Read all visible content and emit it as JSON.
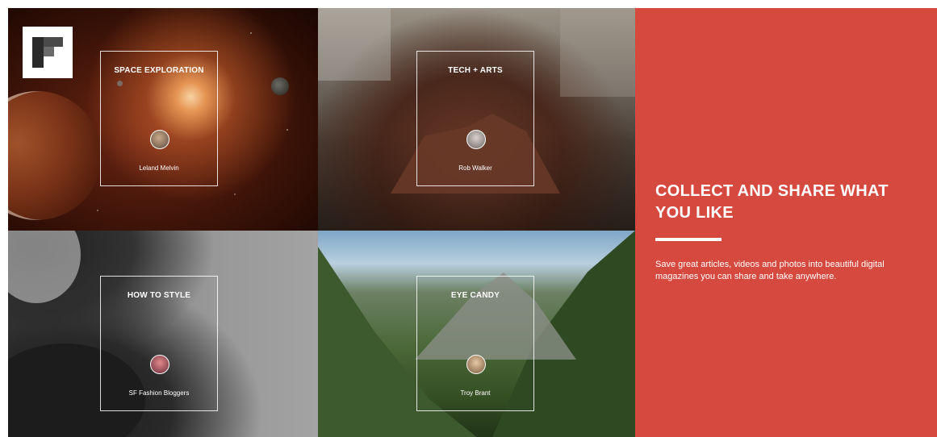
{
  "brand": {
    "logo_icon": "flipboard-logo-icon"
  },
  "tiles": [
    {
      "title": "SPACE EXPLORATION",
      "curator": "Leland Melvin",
      "avatar_icon": "curator-avatar-icon"
    },
    {
      "title": "TECH + ARTS",
      "curator": "Rob Walker",
      "avatar_icon": "curator-avatar-icon"
    },
    {
      "title": "HOW TO STYLE",
      "curator": "SF Fashion Bloggers",
      "avatar_icon": "curator-avatar-icon"
    },
    {
      "title": "EYE CANDY",
      "curator": "Troy Brant",
      "avatar_icon": "curator-avatar-icon"
    }
  ],
  "promo": {
    "headline": "COLLECT AND SHARE WHAT YOU LIKE",
    "description": "Save great articles, videos and photos into beautiful digital magazines you can share and take anywhere.",
    "accent_color": "#d6493f"
  }
}
